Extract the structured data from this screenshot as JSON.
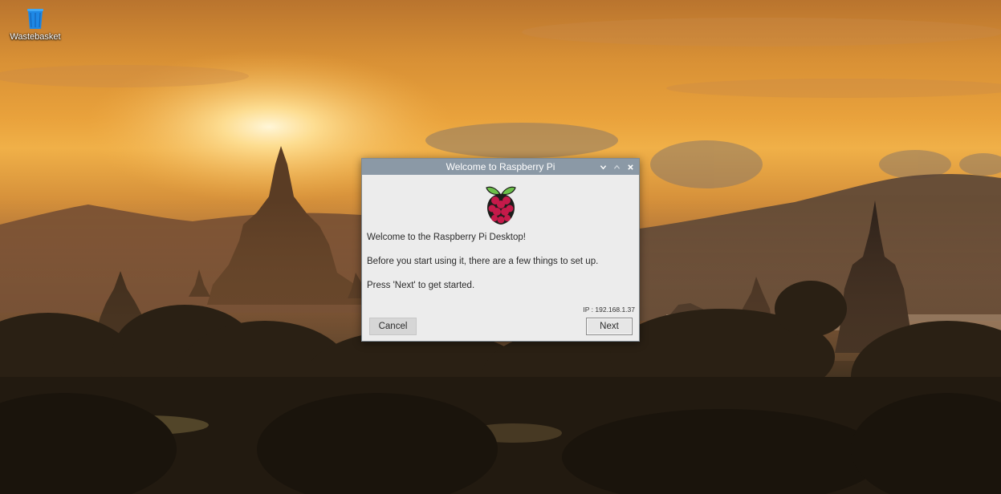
{
  "desktop": {
    "icons": [
      {
        "label": "Wastebasket",
        "icon": "trash-bin-icon"
      }
    ],
    "wallpaper": "sunset-temples"
  },
  "dialog": {
    "title": "Welcome to Raspberry Pi",
    "controls": {
      "minimize": "chevron-down-icon",
      "maximize": "chevron-up-icon",
      "close": "close-icon"
    },
    "logo": "raspberry-pi-logo",
    "lines": [
      "Welcome to the Raspberry Pi Desktop!",
      "Before you start using it, there are a few things to set up.",
      "Press 'Next' to get started."
    ],
    "ip_text": "IP : 192.168.1.37",
    "buttons": {
      "cancel": "Cancel",
      "next": "Next"
    }
  },
  "colors": {
    "titlebar": "#8b99a6",
    "dialog_bg": "#ececec",
    "raspberry_red": "#c51a4a",
    "leaf_green": "#6cc04a",
    "bin_blue": "#1e88e5"
  }
}
